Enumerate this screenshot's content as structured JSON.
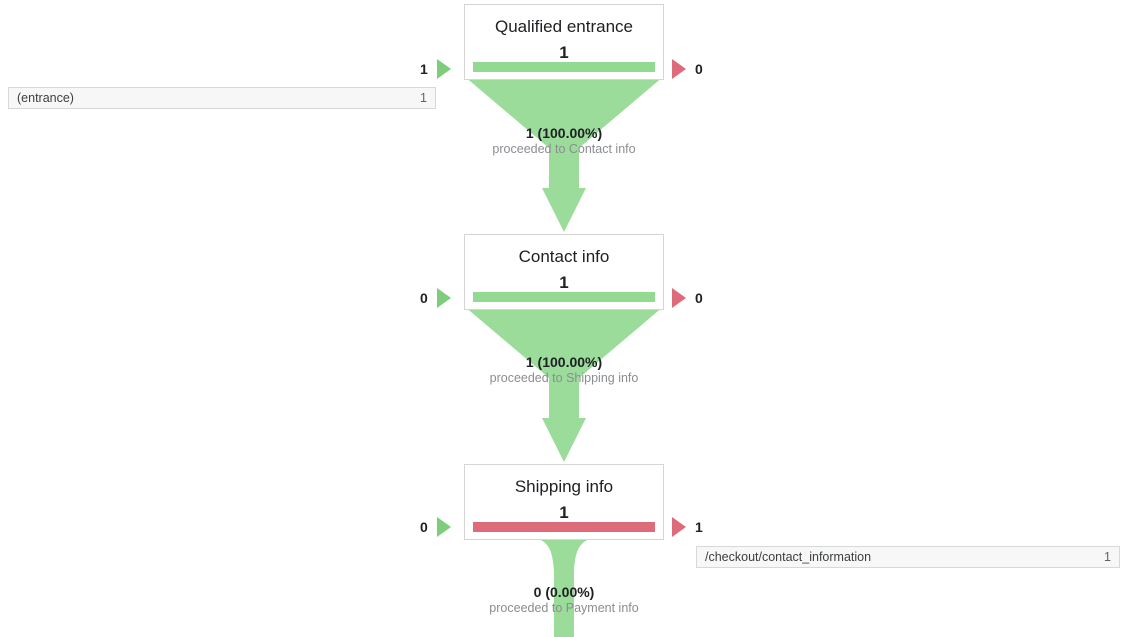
{
  "chart_data": {
    "type": "funnel",
    "title": "",
    "stages": [
      {
        "name": "Qualified entrance",
        "value": "1",
        "bar_color": "#92d992",
        "bar_state": "green",
        "entries": "1",
        "exits": "0",
        "conversion_count": "1",
        "conversion_percent": "(100.00%)",
        "conversion_text": "proceeded to Contact info"
      },
      {
        "name": "Contact info",
        "value": "1",
        "bar_color": "#92d992",
        "bar_state": "green",
        "entries": "0",
        "exits": "0",
        "conversion_count": "1",
        "conversion_percent": "(100.00%)",
        "conversion_text": "proceeded to Shipping info"
      },
      {
        "name": "Shipping info",
        "value": "1",
        "bar_color": "#dd6b79",
        "bar_state": "red",
        "entries": "0",
        "exits": "1",
        "conversion_count": "0",
        "conversion_percent": "(0.00%)",
        "conversion_text": "proceeded to Payment info"
      }
    ],
    "entrance_sources": [
      {
        "label": "(entrance)",
        "count": "1"
      }
    ],
    "exit_destinations": [
      {
        "label": "/checkout/contact_information",
        "count": "1"
      }
    ],
    "colors": {
      "green": "#92d992",
      "green_arrow": "#7dcd7d",
      "red": "#dd6b79",
      "text": "#202124",
      "muted": "#8a8d91"
    }
  }
}
